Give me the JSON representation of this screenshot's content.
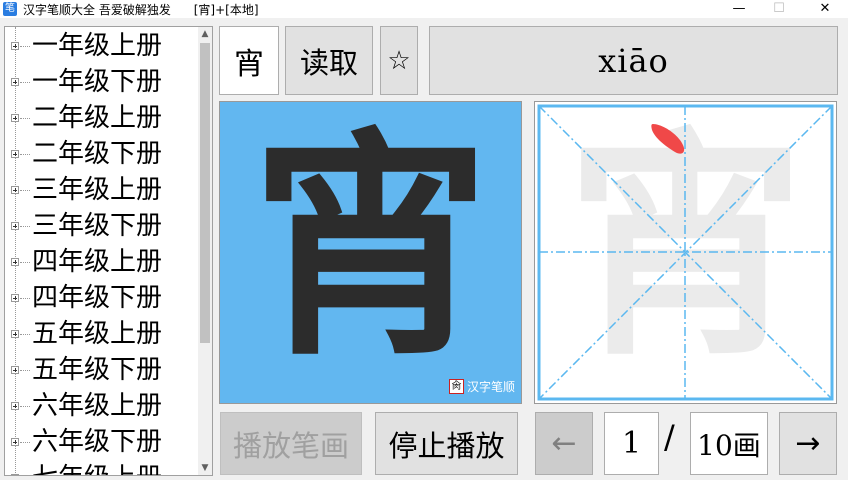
{
  "window": {
    "app_name": "汉字笔顺大全",
    "subtitle": "吾爱破解独发",
    "context": "[宵]+[本地]",
    "minimize": "—",
    "maximize": "☐",
    "close": "✕"
  },
  "tree": {
    "items": [
      "一年级上册",
      "一年级下册",
      "二年级上册",
      "二年级下册",
      "三年级上册",
      "三年级下册",
      "四年级上册",
      "四年级下册",
      "五年级上册",
      "五年级下册",
      "六年级上册",
      "六年级下册",
      "七年级上册"
    ],
    "scroll_up": "▲",
    "scroll_down": "▼"
  },
  "toolbar": {
    "char_input": "宵",
    "read_label": "读取",
    "star_label": "☆",
    "pinyin": "xiāo"
  },
  "display": {
    "character": "宵",
    "watermark_seal": "肏",
    "watermark_text": "汉字笔顺"
  },
  "controls": {
    "play_label": "播放笔画",
    "stop_label": "停止播放",
    "prev_label": "←",
    "current_stroke": "1",
    "slash": "/",
    "total_strokes": "10画",
    "next_label": "→"
  },
  "colors": {
    "panel_blue": "#62b7f0",
    "grid_blue": "#5bb8f0",
    "stroke_red": "#f04848"
  }
}
